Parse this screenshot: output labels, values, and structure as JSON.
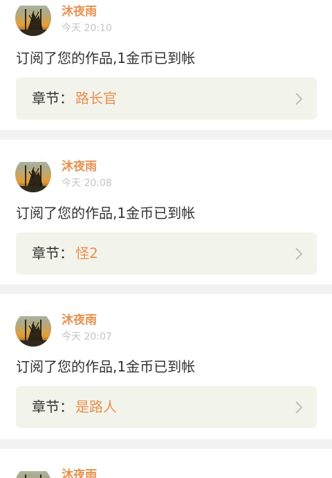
{
  "notifications": [
    {
      "user": "沐夜雨",
      "time": "今天 20:10",
      "message": "订阅了您的作品,1金币已到帐",
      "chapter_label": "章节：",
      "chapter_title": "路长官"
    },
    {
      "user": "沐夜雨",
      "time": "今天 20:08",
      "message": "订阅了您的作品,1金币已到帐",
      "chapter_label": "章节：",
      "chapter_title": "怪2"
    },
    {
      "user": "沐夜雨",
      "time": "今天 20:07",
      "message": "订阅了您的作品,1金币已到帐",
      "chapter_label": "章节：",
      "chapter_title": "是路人"
    },
    {
      "user": "沐夜雨"
    }
  ],
  "icons": {
    "avatar": "avatar-image",
    "arrow": "chevron-right-icon"
  },
  "colors": {
    "background": "#f2f2f2",
    "card": "#ffffff",
    "accent": "#e8904e",
    "chapter_bg": "#f2f4ec",
    "text": "#333333",
    "muted": "#c3c3c3",
    "chevron": "#bdbdbd"
  }
}
